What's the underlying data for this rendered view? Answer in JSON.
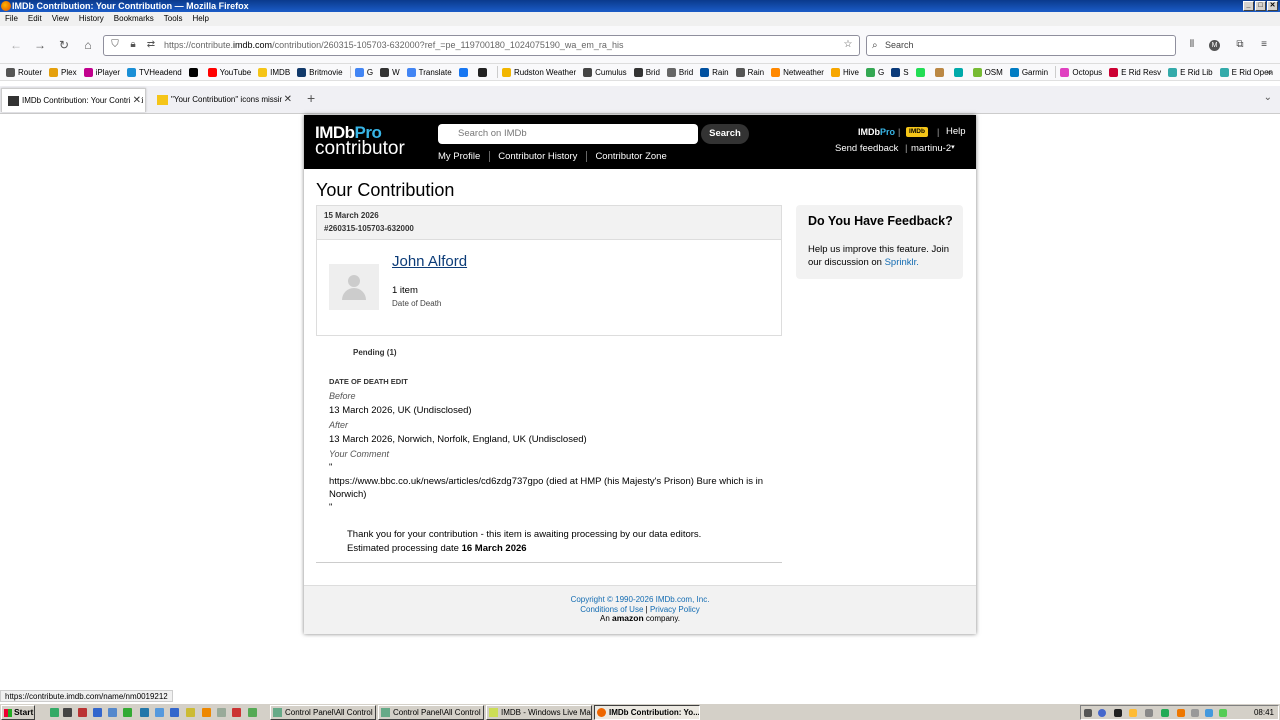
{
  "window": {
    "title": "IMDb Contribution: Your Contribution — Mozilla Firefox",
    "controls": [
      "_",
      "□",
      "✕"
    ]
  },
  "menu": [
    "File",
    "Edit",
    "View",
    "History",
    "Bookmarks",
    "Tools",
    "Help"
  ],
  "browser": {
    "url_prefix": "https://contribute.",
    "url_domain": "imdb.com",
    "url_rest": "/contribution/260315-105703-632000?ref_=pe_119700180_1024075190_wa_em_ra_his",
    "search_placeholder": "Search"
  },
  "bookmarks": [
    {
      "label": "Router",
      "color": "#555"
    },
    {
      "label": "Plex",
      "color": "#e5a00d"
    },
    {
      "label": "iPlayer",
      "color": "#c1008d"
    },
    {
      "label": "TVHeadend",
      "color": "#1a8fd6"
    },
    {
      "label": "",
      "color": "#000"
    },
    {
      "label": "YouTube",
      "color": "#f00"
    },
    {
      "label": "IMDB",
      "color": "#f5c518"
    },
    {
      "label": "Britmovie",
      "color": "#123a6b"
    },
    {
      "label": "G",
      "color": "#4285f4"
    },
    {
      "label": "W",
      "color": "#333"
    },
    {
      "label": "Translate",
      "color": "#4285f4"
    },
    {
      "label": "",
      "color": "#1877f2"
    },
    {
      "label": "",
      "color": "#222"
    },
    {
      "label": "Rudston Weather",
      "color": "#f2b600"
    },
    {
      "label": "Cumulus",
      "color": "#444"
    },
    {
      "label": "Brid",
      "color": "#333"
    },
    {
      "label": "Brid",
      "color": "#666"
    },
    {
      "label": "Rain",
      "color": "#0050a0"
    },
    {
      "label": "Rain",
      "color": "#555"
    },
    {
      "label": "Netweather",
      "color": "#f80"
    },
    {
      "label": "Hive",
      "color": "#f7a600"
    },
    {
      "label": "G",
      "color": "#34a853"
    },
    {
      "label": "S",
      "color": "#0a3a7a"
    },
    {
      "label": "",
      "color": "#2d5"
    },
    {
      "label": "",
      "color": "#b84"
    },
    {
      "label": "",
      "color": "#0aa"
    },
    {
      "label": "OSM",
      "color": "#7b3"
    },
    {
      "label": "Garmin",
      "color": "#007cc3"
    },
    {
      "label": "Octopus",
      "color": "#e040c0"
    },
    {
      "label": "E Rid Resv",
      "color": "#c03"
    },
    {
      "label": "E Rid Lib",
      "color": "#3aa"
    },
    {
      "label": "E Rid Open",
      "color": "#3aa"
    }
  ],
  "tabs": {
    "active": "IMDb Contribution: Your Contributi",
    "other": "\"Your Contribution\" icons missing |",
    "new_tab": "+"
  },
  "imdb": {
    "logo_main": "IMDb",
    "logo_pro": "Pro",
    "logo_sub": "contributor",
    "search_placeholder": "Search on IMDb",
    "search_button": "Search",
    "nav": [
      "My Profile",
      "Contributor History",
      "Contributor Zone"
    ],
    "badge_imdbpro": "IMDb",
    "badge_imdbpro_pro": "Pro",
    "badge_imdb": "IMDb",
    "help": "Help",
    "send_feedback": "Send feedback",
    "separator": "|",
    "user": "martinu-2"
  },
  "contribution": {
    "page_title": "Your Contribution",
    "date": "15 March 2026",
    "id": "#260315-105703-632000",
    "person_name": "John Alford",
    "item_count": "1 item",
    "item_field": "Date of Death",
    "pending_tab": "Pending (1)",
    "edit_heading": "DATE OF DEATH EDIT",
    "before_label": "Before",
    "before_value": "13 March 2026, UK (Undisclosed)",
    "after_label": "After",
    "after_value": "13 March 2026, Norwich, Norfolk, England, UK (Undisclosed)",
    "comment_label": "Your Comment",
    "comment_open_quote": "\"",
    "comment_value": "https://www.bbc.co.uk/news/articles/cd6zdg737gpo (died at HMP (his Majesty's Prison) Bure which is in Norwich)",
    "comment_close_quote": "\"",
    "thanks_line": "Thank you for your contribution - this item is awaiting processing by our data editors.",
    "estimate_label": "Estimated processing date",
    "estimate_date": "16 March 2026"
  },
  "feedback": {
    "title": "Do You Have Feedback?",
    "text": "Help us improve this feature. Join our discussion on",
    "link": "Sprinklr."
  },
  "footer": {
    "copyright": "Copyright © 1990-2026 IMDb.com, Inc.",
    "terms": "Conditions of Use",
    "sep": "|",
    "privacy": "Privacy Policy",
    "an": "An",
    "amazon": "amazon",
    "company": "company."
  },
  "status_url": "https://contribute.imdb.com/name/nm0019212",
  "taskbar": {
    "start": "Start",
    "tasks": [
      "Control Panel\\All Control ...",
      "Control Panel\\All Control ...",
      "IMDB - Windows Live Mail",
      "IMDb Contribution: Yo..."
    ],
    "clock": "08:41"
  }
}
